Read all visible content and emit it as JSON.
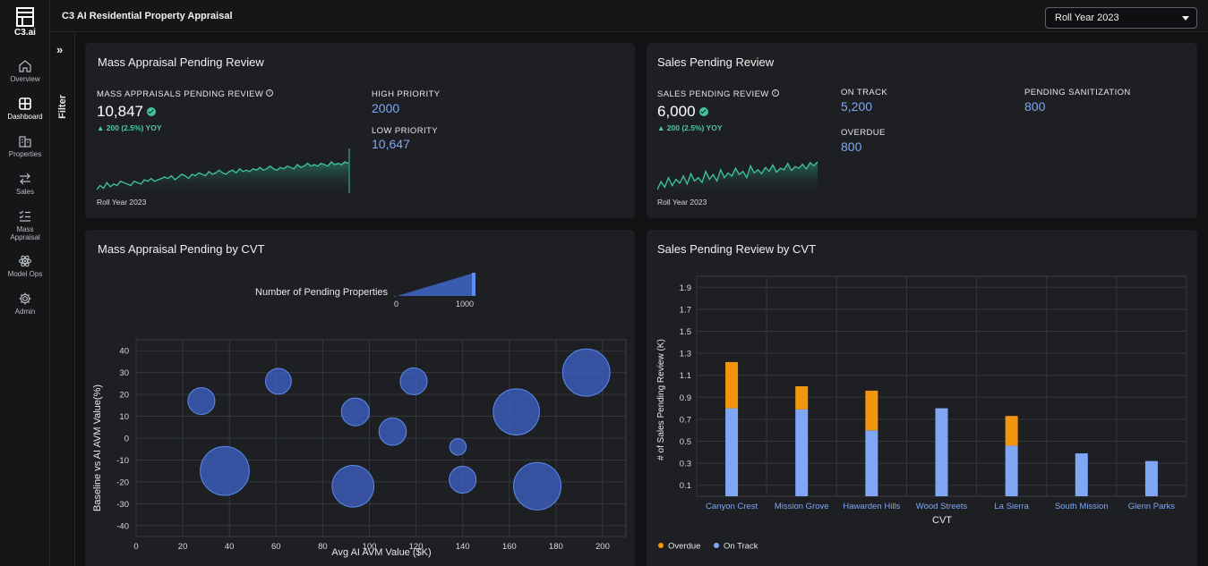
{
  "app": {
    "brand": "C3.ai",
    "title": "C3 AI Residential Property Appraisal"
  },
  "roll_year_select": {
    "value": "Roll Year 2023"
  },
  "filter": {
    "label": "Filter"
  },
  "nav": [
    {
      "label": "Overview",
      "icon": "home-icon"
    },
    {
      "label": "Dashboard",
      "icon": "grid-icon",
      "active": true
    },
    {
      "label": "Properties",
      "icon": "buildings-icon"
    },
    {
      "label": "Sales",
      "icon": "swap-arrows-icon"
    },
    {
      "label": "Mass Appraisal",
      "icon": "checklist-icon"
    },
    {
      "label": "Model Ops",
      "icon": "atom-icon"
    },
    {
      "label": "Admin",
      "icon": "gear-icon"
    }
  ],
  "mass_card": {
    "title": "Mass Appraisal Pending Review",
    "metric_label": "MASS APPRAISALS PENDING REVIEW",
    "metric_value": "10,847",
    "yoy": "▲ 200 (2.5%) YOY",
    "high_label": "HIGH PRIORITY",
    "high_value": "2000",
    "low_label": "LOW PRIORITY",
    "low_value": "10,647",
    "caption": "Roll Year 2023"
  },
  "sales_card": {
    "title": "Sales Pending Review",
    "metric_label": "SALES PENDING REVIEW",
    "metric_value": "6,000",
    "yoy": "▲ 200 (2.5%) YOY",
    "on_track_label": "ON TRACK",
    "on_track_value": "5,200",
    "overdue_label": "OVERDUE",
    "overdue_value": "800",
    "sanitization_label": "PENDING SANITIZATION",
    "sanitization_value": "800",
    "caption": "Roll Year 2023"
  },
  "colors": {
    "accent_green": "#3fc79b",
    "bubble_blue": "#4a72d8",
    "on_track": "#7fa7f5",
    "overdue": "#f2960f"
  },
  "chart_data": [
    {
      "type": "line",
      "title": "",
      "note": "Mass appraisal sparkline (unlabeled)",
      "values": [
        30,
        33,
        31,
        35,
        32,
        34,
        33,
        36,
        35,
        34,
        33,
        36,
        35,
        34,
        37,
        36,
        38,
        36,
        37,
        38,
        39,
        38,
        40,
        37,
        39,
        41,
        40,
        38,
        41,
        40,
        42,
        41,
        40,
        43,
        41,
        42,
        44,
        42,
        41,
        43,
        44,
        42,
        45,
        43,
        44,
        43,
        45,
        44,
        46,
        44,
        45,
        47,
        45,
        44,
        46,
        45,
        47,
        46,
        45,
        48,
        46,
        47,
        49,
        47,
        48,
        47,
        49,
        48,
        47,
        50,
        48,
        49,
        48,
        50,
        49
      ]
    },
    {
      "type": "line",
      "title": "",
      "note": "Sales sparkline (unlabeled)",
      "values": [
        25,
        35,
        28,
        40,
        30,
        38,
        33,
        42,
        32,
        45,
        36,
        40,
        34,
        48,
        38,
        44,
        36,
        50,
        40,
        46,
        42,
        52,
        44,
        48,
        40,
        55,
        46,
        50,
        45,
        53,
        48,
        56,
        47,
        52,
        50,
        58,
        49,
        54,
        52,
        57,
        51,
        59,
        55,
        60
      ]
    },
    {
      "type": "scatter",
      "title": "Mass Appraisal Pending by CVT",
      "size_legend_title": "Number of Pending Properties",
      "size_legend_ticks": [
        "0",
        "1000"
      ],
      "xlabel": "Avg AI AVM Value ($K)",
      "ylabel": "Baseline vs AI AVM Value(%)",
      "xlim": [
        0,
        210
      ],
      "ylim": [
        -45,
        45
      ],
      "xticks": [
        0,
        20,
        40,
        60,
        80,
        100,
        120,
        140,
        160,
        180,
        200
      ],
      "yticks": [
        40,
        30,
        20,
        10,
        0,
        -10,
        -20,
        -30,
        -40
      ],
      "points": [
        {
          "x": 28,
          "y": 17,
          "size": 180
        },
        {
          "x": 38,
          "y": -15,
          "size": 800
        },
        {
          "x": 61,
          "y": 26,
          "size": 160
        },
        {
          "x": 93,
          "y": -22,
          "size": 550
        },
        {
          "x": 94,
          "y": 12,
          "size": 200
        },
        {
          "x": 110,
          "y": 3,
          "size": 190
        },
        {
          "x": 119,
          "y": 26,
          "size": 180
        },
        {
          "x": 138,
          "y": -4,
          "size": 40
        },
        {
          "x": 140,
          "y": -19,
          "size": 180
        },
        {
          "x": 163,
          "y": 12,
          "size": 700
        },
        {
          "x": 172,
          "y": -22,
          "size": 750
        },
        {
          "x": 193,
          "y": 30,
          "size": 740
        }
      ]
    },
    {
      "type": "bar",
      "title": "Sales Pending Review by CVT",
      "stacked": true,
      "xlabel": "CVT",
      "ylabel": "# of Sales Pending Review (K)",
      "ylim": [
        0,
        2.0
      ],
      "yticks": [
        0.1,
        0.3,
        0.5,
        0.7,
        0.9,
        1.1,
        1.3,
        1.5,
        1.7,
        1.9
      ],
      "categories": [
        "Canyon Crest",
        "Mission Grove",
        "Hawarden Hills",
        "Wood Streets",
        "La Sierra",
        "South Mission",
        "Glenn Parks"
      ],
      "series": [
        {
          "name": "On Track",
          "values": [
            0.8,
            0.79,
            0.6,
            0.8,
            0.46,
            0.39,
            0.32
          ]
        },
        {
          "name": "Overdue",
          "values": [
            0.42,
            0.21,
            0.36,
            0,
            0.27,
            0,
            0
          ]
        }
      ],
      "legend": "bottom-left",
      "grid": true
    }
  ]
}
